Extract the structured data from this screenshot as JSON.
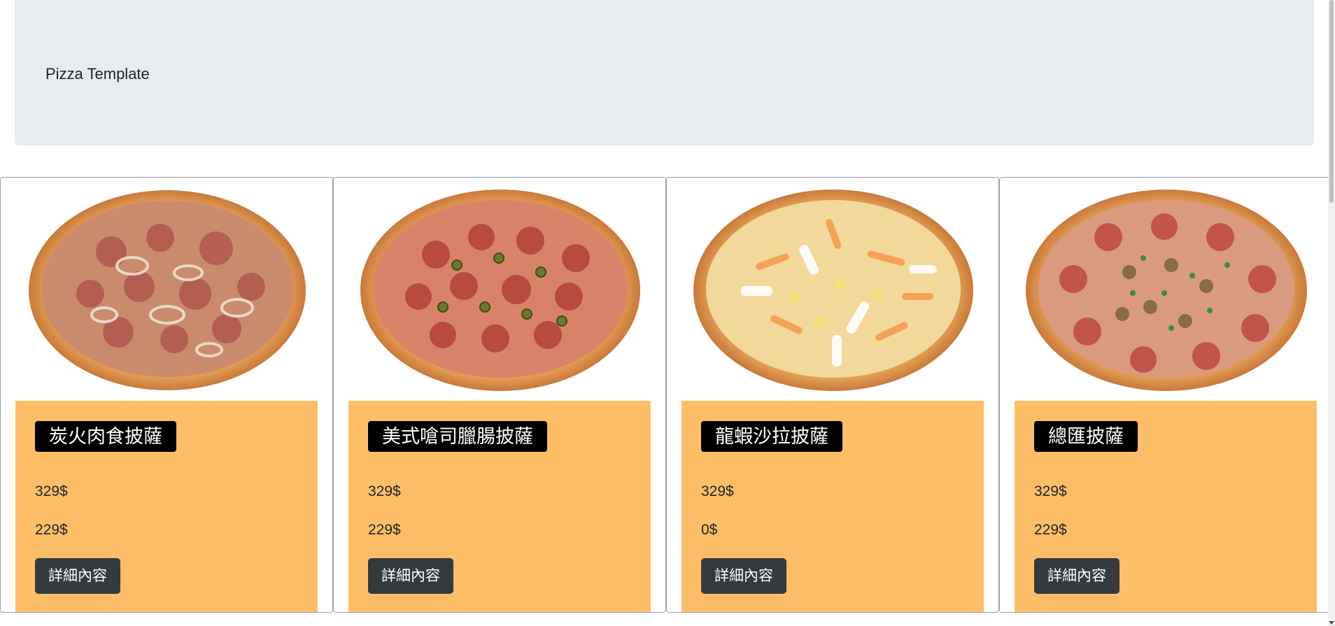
{
  "header": {
    "brand": "Pizza Template"
  },
  "cards": [
    {
      "name": "炭火肉食披薩",
      "price_regular": "329$",
      "price_sale": "229$",
      "button_label": "詳細內容",
      "image": "pizza-meat-onion"
    },
    {
      "name": "美式嗆司臘腸披薩",
      "price_regular": "329$",
      "price_sale": "229$",
      "button_label": "詳細內容",
      "image": "pizza-pepperoni-jalapeno"
    },
    {
      "name": "龍蝦沙拉披薩",
      "price_regular": "329$",
      "price_sale": "0$",
      "button_label": "詳細內容",
      "image": "pizza-seafood-salad"
    },
    {
      "name": "總匯披薩",
      "price_regular": "329$",
      "price_sale": "229$",
      "button_label": "詳細內容",
      "image": "pizza-supreme"
    }
  ],
  "colors": {
    "jumbotron_bg": "#e9ecef",
    "card_body_bg": "#fdbe67",
    "name_badge_bg": "#000000",
    "button_bg": "#343a40"
  }
}
